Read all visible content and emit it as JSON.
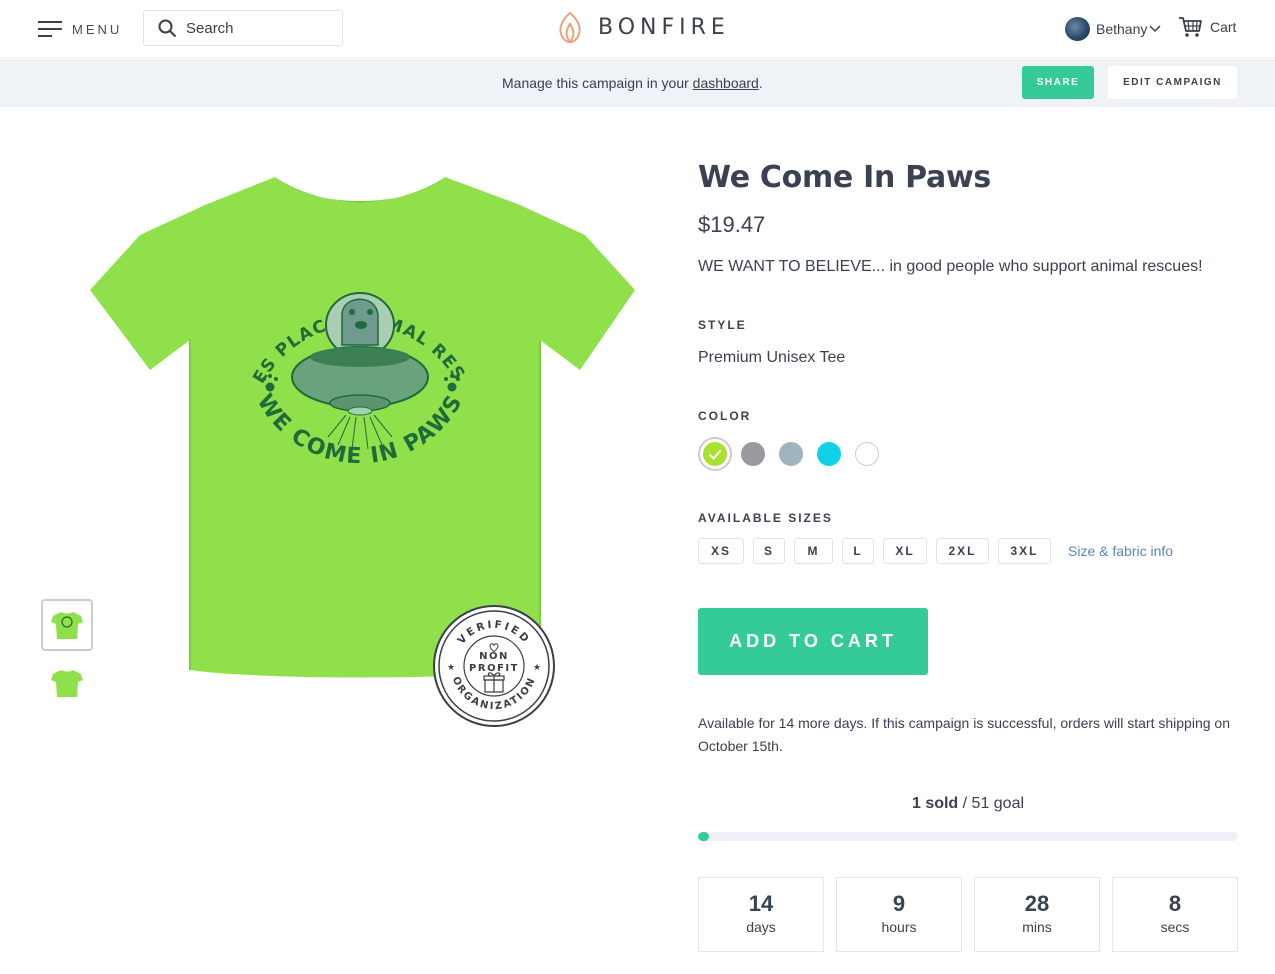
{
  "header": {
    "menu_label": "MENU",
    "search_placeholder": "Search",
    "brand": "BONFIRE",
    "user_name": "Bethany",
    "cart_label": "Cart"
  },
  "manage_bar": {
    "text_before": "Manage this campaign in your ",
    "link": "dashboard",
    "text_after": ".",
    "share_label": "SHARE",
    "edit_label": "EDIT CAMPAIGN"
  },
  "artwork": {
    "top_arc": "ODIES PLACE ANIMAL RESCUE",
    "bottom_arc": "WE COME IN PAWS"
  },
  "badge": {
    "top_arc": "VERIFIED",
    "bottom_arc": "ORGANIZATION",
    "line1": "NON",
    "line2": "PROFIT"
  },
  "product": {
    "title": "We Come In Paws",
    "price": "$19.47",
    "description": "WE WANT TO BELIEVE... in good people who support animal rescues!",
    "style_label": "STYLE",
    "style_value": "Premium Unisex Tee",
    "color_label": "COLOR",
    "colors": [
      {
        "name": "neon-green",
        "hex": "#a6e22e",
        "selected": true
      },
      {
        "name": "grey",
        "hex": "#9a9a9e",
        "selected": false
      },
      {
        "name": "light-blue-grey",
        "hex": "#9fb4bf",
        "selected": false
      },
      {
        "name": "cyan",
        "hex": "#0fd2e6",
        "selected": false
      },
      {
        "name": "white",
        "hex": "#ffffff",
        "selected": false
      }
    ],
    "sizes_label": "AVAILABLE SIZES",
    "sizes": [
      "XS",
      "S",
      "M",
      "L",
      "XL",
      "2XL",
      "3XL"
    ],
    "size_info_link": "Size & fabric info",
    "add_to_cart": "ADD TO CART",
    "availability": "Available for 14 more days. If this campaign is successful, orders will start shipping on October 15th."
  },
  "campaign": {
    "sold_count": "1 sold",
    "goal": " / 51 goal",
    "progress_fraction": 0.0196,
    "countdown": [
      {
        "value": "14",
        "unit": "days"
      },
      {
        "value": "9",
        "unit": "hours"
      },
      {
        "value": "28",
        "unit": "mins"
      },
      {
        "value": "8",
        "unit": "secs"
      }
    ]
  },
  "colors": {
    "accent": "#35cb98",
    "shirt": "#8fe04a",
    "print": "#1f6b3a",
    "link": "#5b87b8"
  }
}
